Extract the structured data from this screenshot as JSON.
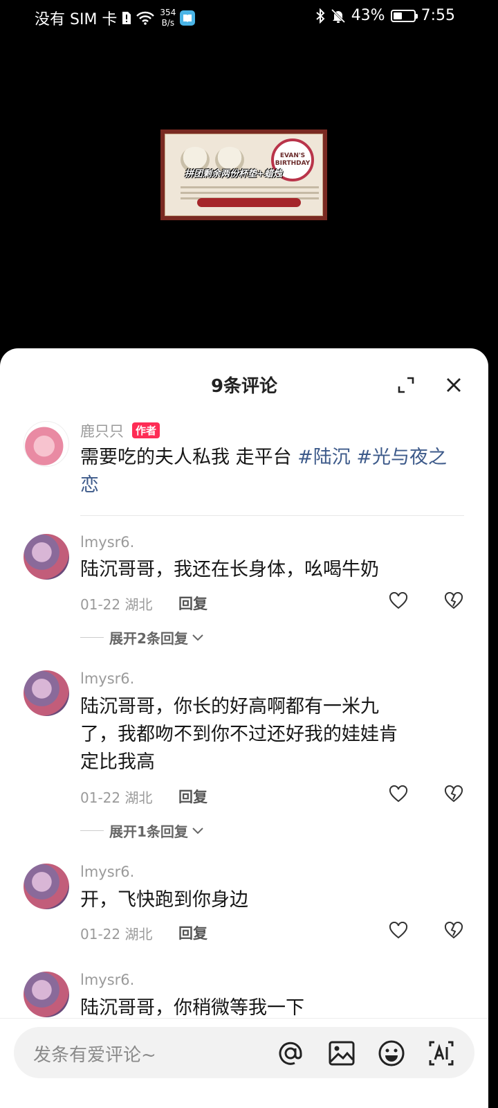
{
  "status_bar": {
    "carrier": "没有 SIM 卡",
    "speed_value": "354",
    "speed_unit": "B/s",
    "battery": "43%",
    "battery_level": 0.43,
    "time": "7:55",
    "icons": [
      "sim-alert-icon",
      "wifi-icon",
      "book-app-icon",
      "bluetooth-icon",
      "mute-bell-icon",
      "battery-icon"
    ]
  },
  "video": {
    "caption": "拼团剩余两份杯垫+蜡烛",
    "badge_text": "EVAN'S BIRTHDAY"
  },
  "sheet": {
    "title": "9条评论",
    "icons": [
      "expand-icon",
      "close-icon"
    ]
  },
  "author_post": {
    "username": "鹿只只",
    "tag": "作者",
    "text": "需要吃的夫人私我 走平台 ",
    "hashtags": [
      "#陆沉",
      "#光与夜之恋"
    ]
  },
  "comments": [
    {
      "username": "lmysr6.",
      "text": "陆沉哥哥，我还在长身体，吆喝牛奶",
      "date": "01-22",
      "location": "湖北",
      "reply_label": "回复",
      "expand_label": "展开2条回复"
    },
    {
      "username": "lmysr6.",
      "text_lines": [
        "陆沉哥哥，你长的好高啊都有一米九",
        "了，我都吻不到你不过还好我的娃娃肯",
        "定比我高"
      ],
      "date": "01-22",
      "location": "湖北",
      "reply_label": "回复",
      "expand_label": "展开1条回复"
    },
    {
      "username": "lmysr6.",
      "text": "开，飞快跑到你身边",
      "date": "01-22",
      "location": "湖北",
      "reply_label": "回复"
    },
    {
      "username": "lmysr6.",
      "text": "陆沉哥哥，你稍微等我一下"
    }
  ],
  "input": {
    "placeholder": "发条有爱评论~",
    "icons": [
      "at-icon",
      "image-icon",
      "emoji-icon",
      "ai-icon"
    ]
  }
}
